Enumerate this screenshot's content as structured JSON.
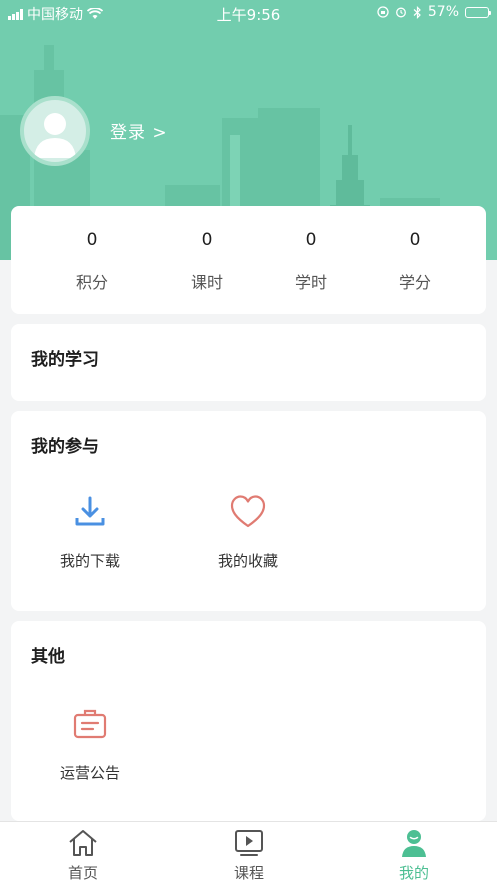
{
  "status_bar": {
    "carrier": "中国移动",
    "time": "上午9:56",
    "battery": "57%",
    "battery_level": 0.57
  },
  "profile": {
    "login_text": "登录 >"
  },
  "stats": [
    {
      "value": "0",
      "label": "积分"
    },
    {
      "value": "0",
      "label": "课时"
    },
    {
      "value": "0",
      "label": "学时"
    },
    {
      "value": "0",
      "label": "学分"
    }
  ],
  "my_study": {
    "title": "我的学习"
  },
  "my_participation": {
    "title": "我的参与",
    "items": [
      {
        "label": "我的下载",
        "icon": "download-icon"
      },
      {
        "label": "我的收藏",
        "icon": "heart-icon"
      }
    ]
  },
  "other": {
    "title": "其他",
    "items": [
      {
        "label": "运营公告",
        "icon": "announcement-icon"
      }
    ]
  },
  "tabbar": {
    "tabs": [
      {
        "label": "首页",
        "icon": "home-icon",
        "active": false
      },
      {
        "label": "课程",
        "icon": "course-video-icon",
        "active": false
      },
      {
        "label": "我的",
        "icon": "profile-icon",
        "active": true
      }
    ]
  },
  "colors": {
    "header": "#72cdae",
    "accent": "#4dbf93",
    "download_icon": "#4a90e2",
    "heart_icon": "#e07b72",
    "announcement_icon": "#e07b72"
  }
}
